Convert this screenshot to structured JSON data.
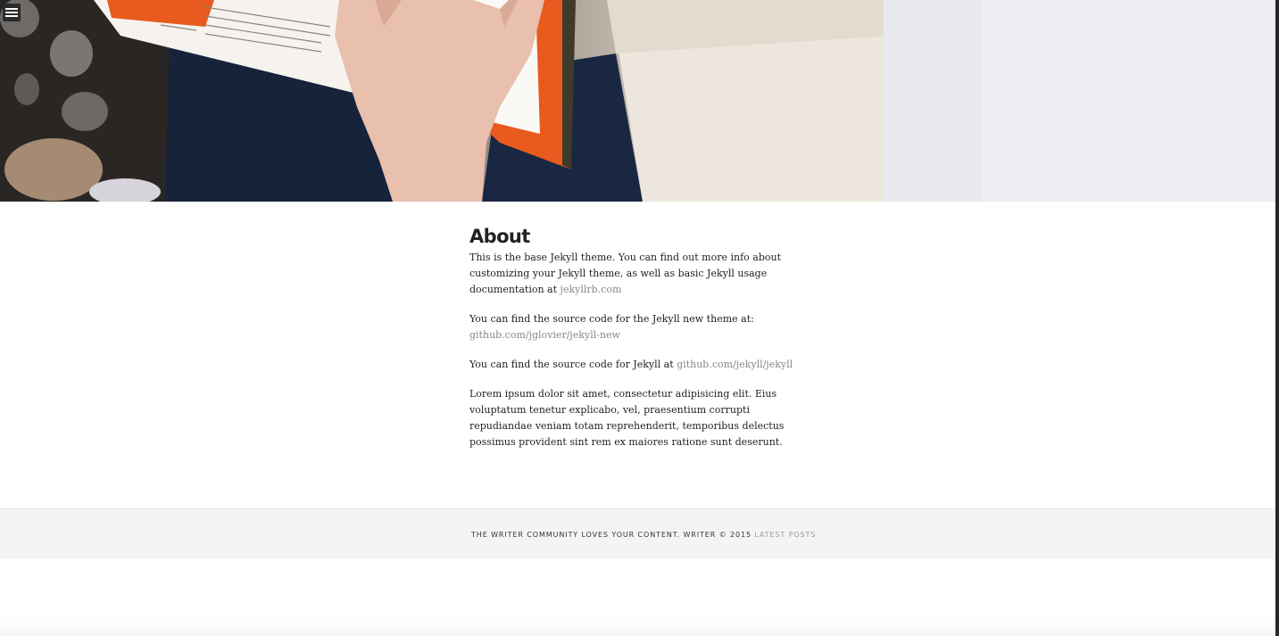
{
  "hero": {
    "image_icon": "photo-of-person-reading-book"
  },
  "nav": {
    "menu_icon": "hamburger-menu-icon"
  },
  "about": {
    "title": "About",
    "p1_text": "This is the base Jekyll theme. You can find out more info about customizing your Jekyll theme, as well as basic Jekyll usage documentation at ",
    "p1_link": "jekyllrb.com",
    "p2_text": "You can find the source code for the Jekyll new theme at: ",
    "p2_link": "github.com/jglovier/jekyll-new",
    "p3_text": "You can find the source code for Jekyll at ",
    "p3_link": "github.com/jekyll/jekyll",
    "p4_text": "Lorem ipsum dolor sit amet, consectetur adipisicing elit. Eius voluptatum tenetur explicabo, vel, praesentium corrupti repudiandae veniam totam reprehenderit, temporibus delectus possimus provident sint rem ex maiores ratione sunt deserunt."
  },
  "footer": {
    "text": "THE WRITER COMMUNITY LOVES YOUR CONTENT. WRITER © 2015 ",
    "link": "LATEST POSTS"
  },
  "colors": {
    "link": "#888888",
    "footer_bg": "#f4f4f4",
    "text": "#222222"
  }
}
